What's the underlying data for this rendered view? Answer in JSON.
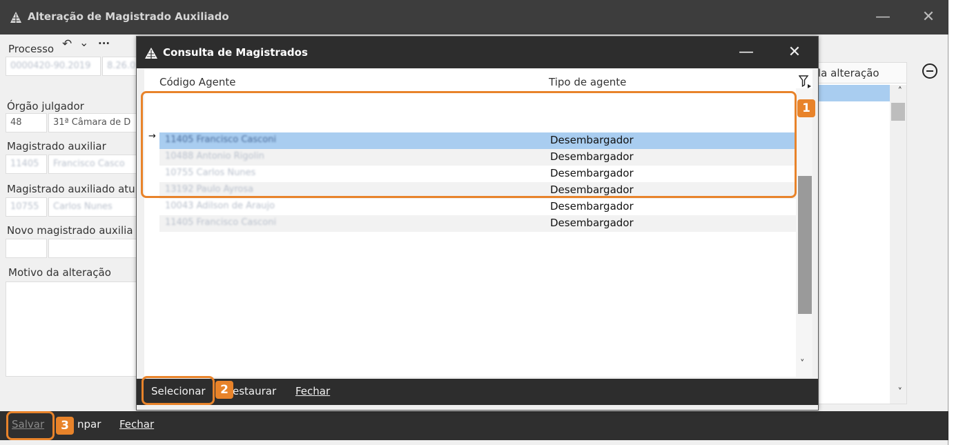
{
  "outer_window": {
    "title": "Alteração de Magistrado Auxiliado",
    "minimize": "—",
    "close": "✕"
  },
  "form": {
    "processo_label": "Processo",
    "processo_value": "0000420-90.2019",
    "processo_value2": "8.26.0",
    "undo_glyph": "↶",
    "chevron_glyph": "⌄",
    "more_glyph": "···",
    "orgao_label": "Órgão julgador",
    "orgao_code": "48",
    "orgao_name": "31ª Câmara de D",
    "mag_aux_label": "Magistrado auxiliar",
    "mag_aux_code": "11405",
    "mag_aux_name": "Francisco Casco",
    "mag_atual_label": "Magistrado auxiliado atu",
    "mag_atual_code": "10755",
    "mag_atual_name": "Carlos Nunes",
    "novo_label": "Novo magistrado auxilia",
    "motivo_label": "Motivo da alteração"
  },
  "right_panel": {
    "header": "la alteração",
    "scroll_up": "˄",
    "scroll_down": "˅"
  },
  "bottom_bar": {
    "salvar": "Salvar",
    "limpar": "npar",
    "fechar": "Fechar"
  },
  "dialog": {
    "title": "Consulta de Magistrados",
    "minimize": "—",
    "close": "✕",
    "col_codigo": "Código Agente",
    "col_tipo": "Tipo de agente",
    "row_marker": "→",
    "rows": [
      {
        "code": "11405  Francisco Casconi",
        "tipo": "Desembargador"
      },
      {
        "code": "10488  Antonio Rigolin",
        "tipo": "Desembargador"
      },
      {
        "code": "10755  Carlos Nunes",
        "tipo": "Desembargador"
      },
      {
        "code": "13192  Paulo Ayrosa",
        "tipo": "Desembargador"
      },
      {
        "code": "10043  Adilson de Araujo",
        "tipo": "Desembargador"
      },
      {
        "code": "11405  Francisco Casconi",
        "tipo": "Desembargador"
      }
    ],
    "scroll_down": "˅",
    "selecionar": "Selecionar",
    "restaurar": "estaurar",
    "fechar": "Fechar"
  },
  "annotations": {
    "badge1": "1",
    "badge2": "2",
    "badge3": "3",
    "color": "#e8832a"
  }
}
